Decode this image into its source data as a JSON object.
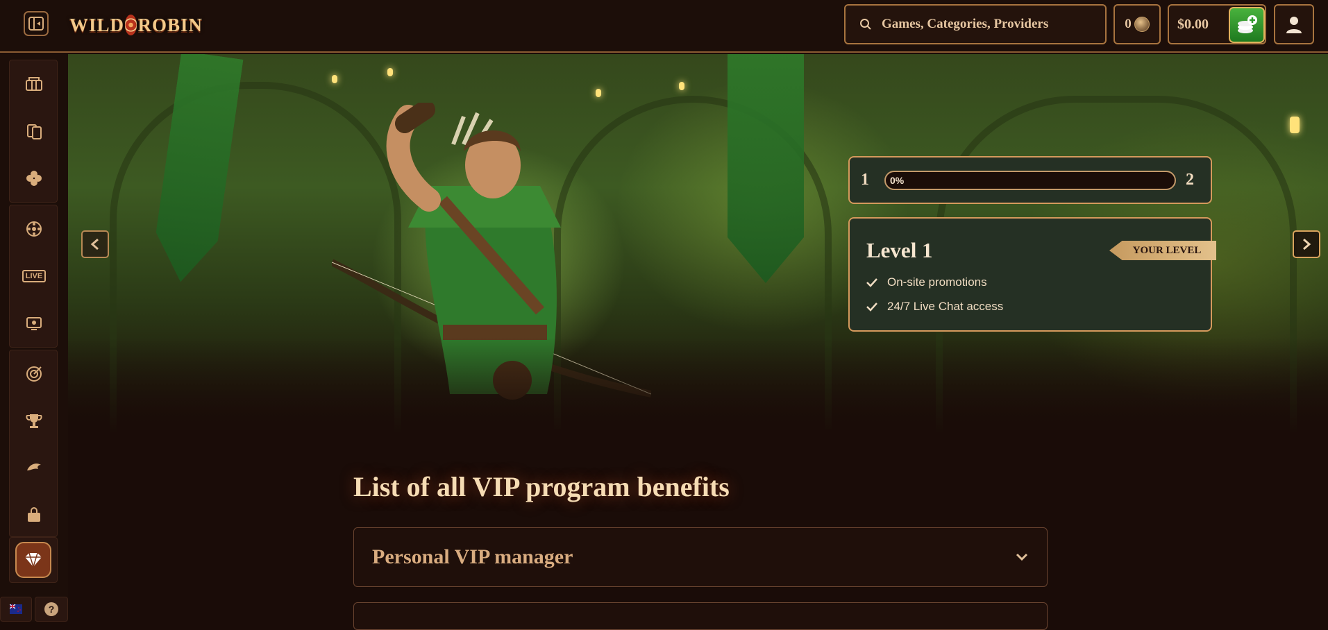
{
  "brand": {
    "logo_text_left": "WILD",
    "logo_text_right": "ROBIN"
  },
  "header": {
    "search_placeholder": "Games, Categories, Providers",
    "coins": "0",
    "balance": "$0.00"
  },
  "sidebar": {
    "groups": [
      [
        "casino-icon",
        "cards-icon",
        "clover-icon"
      ],
      [
        "roulette-icon",
        "live-icon",
        "monitor-icon"
      ],
      [
        "target-icon",
        "trophy-icon",
        "promo-icon",
        "shop-icon"
      ]
    ],
    "live_label": "LIVE",
    "vip_icon": "diamond-icon",
    "help_label": "?"
  },
  "hero": {
    "progress": {
      "current_level": "1",
      "next_level": "2",
      "percent_label": "0%",
      "percent_value": 0
    },
    "level_card": {
      "title": "Level 1",
      "badge": "YOUR LEVEL",
      "benefits": [
        "On-site promotions",
        "24/7 Live Chat access"
      ]
    }
  },
  "content": {
    "section_title": "List of all VIP program benefits",
    "accordions": [
      "Personal VIP manager"
    ]
  },
  "colors": {
    "accent": "#d59a5c",
    "deposit_green": "#2e9a2a",
    "background": "#1a0c08"
  }
}
